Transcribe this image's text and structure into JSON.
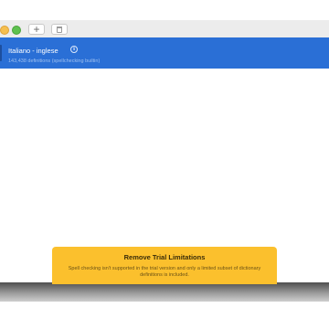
{
  "toolbar": {
    "add_label": "+",
    "add_icon": "plus-icon",
    "trash_icon": "trash-icon"
  },
  "dictionary_list": {
    "items": [
      {
        "title": "Italiano - inglese",
        "subtitle": "143,438 definitions (spellchecking builtin)",
        "selected": true,
        "info_icon": "info-icon"
      }
    ]
  },
  "banner": {
    "title": "Remove Trial Limitations",
    "text": "Spell checking isn't supported in the trial version and only a limited subset of dictionary definitions is included.",
    "color": "#fbc02d"
  },
  "colors": {
    "selection": "#2a6fd6",
    "window_close": "#f5bf4f",
    "window_zoom": "#5ec14f"
  }
}
